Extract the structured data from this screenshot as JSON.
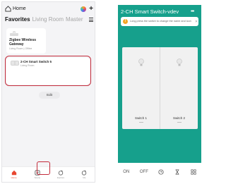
{
  "left_phone": {
    "header": {
      "title": "Home",
      "icons": [
        "house-icon",
        "color-dot-icon",
        "plus-icon"
      ]
    },
    "tabs": [
      {
        "label": "Favorites",
        "active": true
      },
      {
        "label": "Living Room",
        "active": false
      },
      {
        "label": "Master",
        "active": false
      }
    ],
    "cards": [
      {
        "name": "Zigbee Wireless Gateway",
        "room": "Living Room",
        "status": "Offline",
        "icon": "gateway-icon"
      },
      {
        "name": "2-CH Smart Switch 5",
        "room": "Living Room",
        "icon": "switch-icon"
      }
    ],
    "edit_label": "Edit",
    "nav": [
      {
        "label": "Home",
        "icon": "home-icon",
        "active": true
      },
      {
        "label": "Scene",
        "icon": "scene-icon",
        "active": false
      },
      {
        "label": "Explore",
        "icon": "explore-icon",
        "active": false
      },
      {
        "label": "Me",
        "icon": "me-icon",
        "active": false
      }
    ],
    "accent": "#e8462f"
  },
  "right_phone": {
    "title": "2-CH Smart Switch-vdev",
    "tip": "Long press the switch to change the name and icon",
    "switches": [
      {
        "label": "Switch 1",
        "icon": "bulb-icon"
      },
      {
        "label": "Switch 2",
        "icon": "bulb-icon"
      }
    ],
    "bottom": {
      "on_label": "ON",
      "off_label": "OFF",
      "icons": [
        "timer-icon",
        "hourglass-icon",
        "grid-icon"
      ]
    },
    "background": "#16a08c"
  },
  "highlight_color": "#c32b3b"
}
